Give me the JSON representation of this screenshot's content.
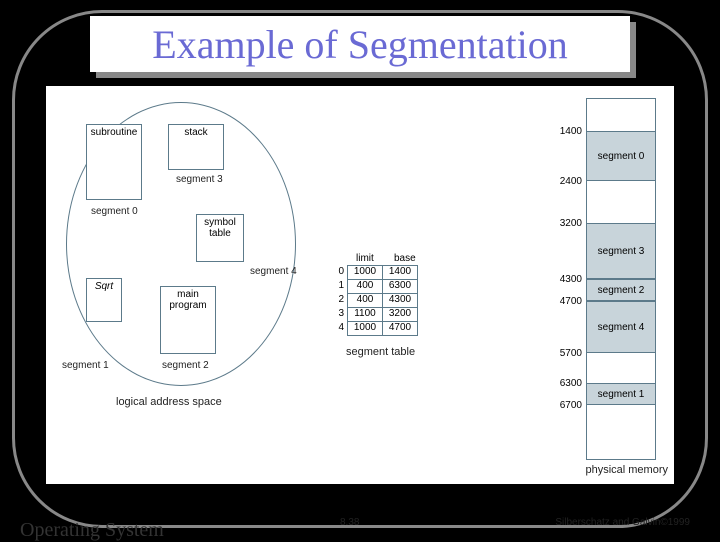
{
  "title": "Example of Segmentation",
  "logical": {
    "subroutine": "subroutine",
    "stack": "stack",
    "symbol_table": "symbol\ntable",
    "sqrt": "Sqrt",
    "main": "main\nprogram",
    "seg0": "segment 0",
    "seg1": "segment 1",
    "seg2": "segment 2",
    "seg3": "segment 3",
    "seg4": "segment 4",
    "caption": "logical address space"
  },
  "segment_table": {
    "headers": {
      "limit": "limit",
      "base": "base"
    },
    "rows": [
      {
        "i": "0",
        "limit": "1000",
        "base": "1400"
      },
      {
        "i": "1",
        "limit": "400",
        "base": "6300"
      },
      {
        "i": "2",
        "limit": "400",
        "base": "4300"
      },
      {
        "i": "3",
        "limit": "1100",
        "base": "3200"
      },
      {
        "i": "4",
        "limit": "1000",
        "base": "4700"
      }
    ],
    "caption": "segment table"
  },
  "physical": {
    "caption": "physical memory",
    "addrs": {
      "a1400": "1400",
      "a2400": "2400",
      "a3200": "3200",
      "a4300": "4300",
      "a4700": "4700",
      "a5700": "5700",
      "a6300": "6300",
      "a6700": "6700"
    },
    "segs": {
      "s0": "segment 0",
      "s1": "segment 1",
      "s2": "segment 2",
      "s3": "segment 3",
      "s4": "segment 4"
    }
  },
  "footer": {
    "left": "Operating System",
    "mid": "8.38",
    "right": "Silberschatz and Galvin©1999"
  }
}
